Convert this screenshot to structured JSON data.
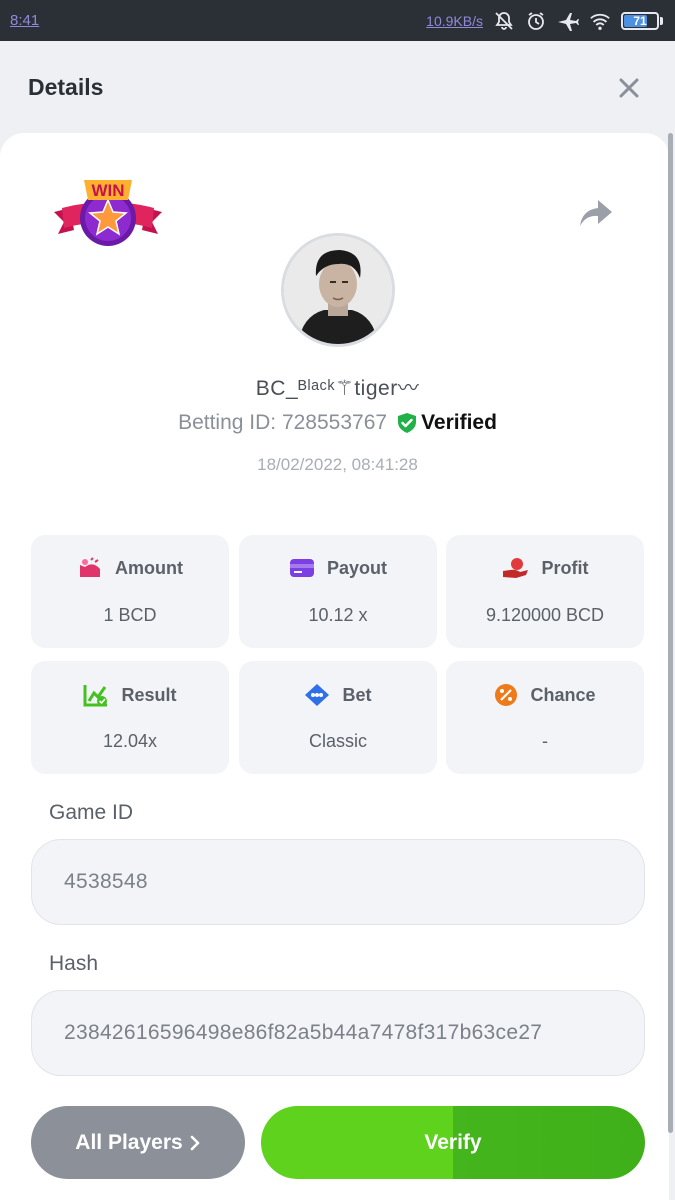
{
  "status_bar": {
    "time": "8:41",
    "net_speed": "10.9KB/s",
    "battery_level": "71",
    "icons": [
      "bell-off-icon",
      "alarm-icon",
      "airplane-icon",
      "wifi-icon",
      "battery-icon"
    ]
  },
  "header": {
    "title": "Details",
    "close_icon": "close-icon"
  },
  "badge": {
    "icon": "win-badge-icon",
    "text": "WIN"
  },
  "share_icon": "share-icon",
  "player": {
    "username": "BC_ᴮˡᵃᶜᵏ⚚tiger〰",
    "betting_id_label": "Betting ID: 728553767",
    "verified_label": "Verified",
    "datetime": "18/02/2022, 08:41:28"
  },
  "stats": [
    {
      "label": "Amount",
      "value": "1 BCD",
      "icon": "amount-icon",
      "color": "#e0356a"
    },
    {
      "label": "Payout",
      "value": "10.12 x",
      "icon": "payout-card-icon",
      "color": "#7b3fe4"
    },
    {
      "label": "Profit",
      "value": "9.120000 BCD",
      "icon": "profit-hand-icon",
      "color": "#e03a3a"
    },
    {
      "label": "Result",
      "value": "12.04x",
      "icon": "result-chart-icon",
      "color": "#43c21f"
    },
    {
      "label": "Bet",
      "value": "Classic",
      "icon": "bet-tag-icon",
      "color": "#2f6fe8"
    },
    {
      "label": "Chance",
      "value": "-",
      "icon": "chance-percent-icon",
      "color": "#ef7a1a"
    }
  ],
  "game": {
    "game_id_label": "Game ID",
    "game_id": "4538548",
    "hash_label": "Hash",
    "hash": "2384261659649​8e86f82a5b44a7478f317b63ce27"
  },
  "buttons": {
    "all_players": "All Players",
    "verify": "Verify"
  },
  "colors": {
    "verify_green": "#5fd21e",
    "players_gray": "#8b9099",
    "verified_green": "#22b04a"
  }
}
